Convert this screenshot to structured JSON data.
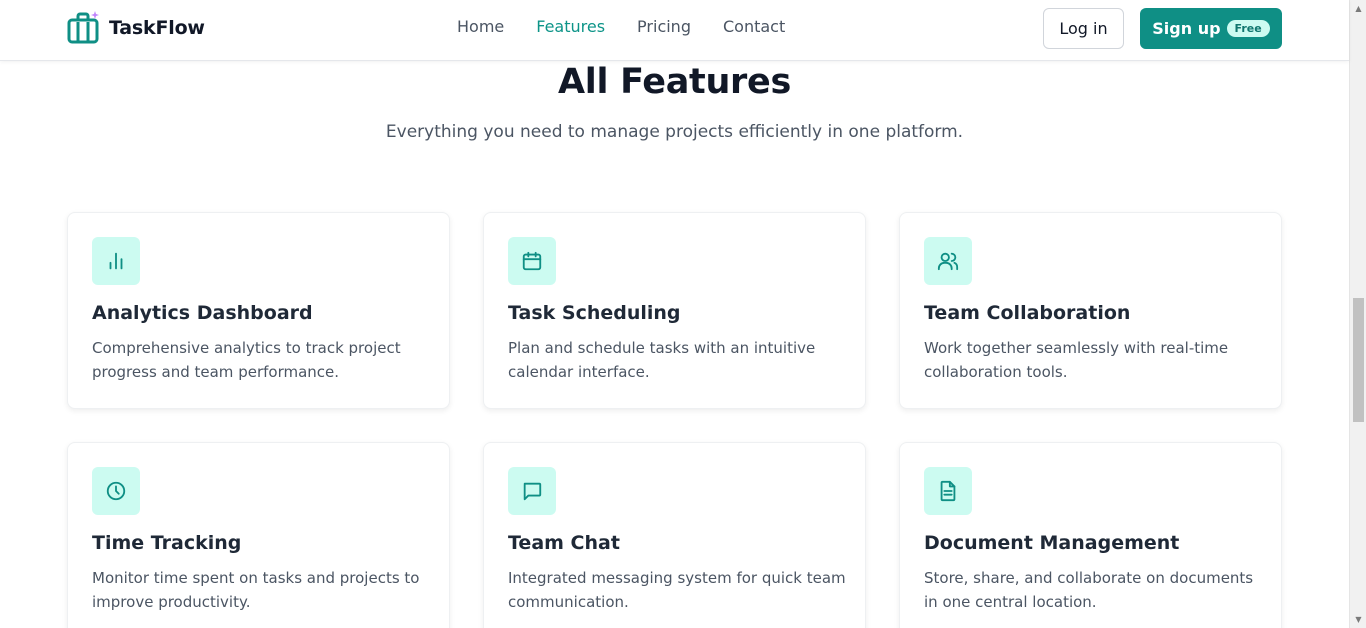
{
  "brand": {
    "name": "TaskFlow",
    "icon": "briefcase-sparkle-icon"
  },
  "nav": {
    "items": [
      {
        "label": "Home",
        "active": false
      },
      {
        "label": "Features",
        "active": true
      },
      {
        "label": "Pricing",
        "active": false
      },
      {
        "label": "Contact",
        "active": false
      }
    ]
  },
  "auth": {
    "login_label": "Log in",
    "signup_label": "Sign up",
    "signup_badge": "Free"
  },
  "hero": {
    "title": "All Features",
    "subtitle": "Everything you need to manage projects efficiently in one platform."
  },
  "features": [
    {
      "icon": "bar-chart-icon",
      "title": "Analytics Dashboard",
      "description": "Comprehensive analytics to track project progress and team performance."
    },
    {
      "icon": "calendar-icon",
      "title": "Task Scheduling",
      "description": "Plan and schedule tasks with an intuitive calendar interface."
    },
    {
      "icon": "users-icon",
      "title": "Team Collaboration",
      "description": "Work together seamlessly with real-time collaboration tools."
    },
    {
      "icon": "clock-icon",
      "title": "Time Tracking",
      "description": "Monitor time spent on tasks and projects to improve productivity."
    },
    {
      "icon": "chat-bubble-icon",
      "title": "Team Chat",
      "description": "Integrated messaging system for quick team communication."
    },
    {
      "icon": "document-icon",
      "title": "Document Management",
      "description": "Store, share, and collaborate on documents in one central location."
    }
  ],
  "colors": {
    "accent": "#0f8f85",
    "accent_text": "#0d9488",
    "icon_bg": "#ccfbf1",
    "heading": "#111827",
    "body_text": "#4b5563"
  }
}
